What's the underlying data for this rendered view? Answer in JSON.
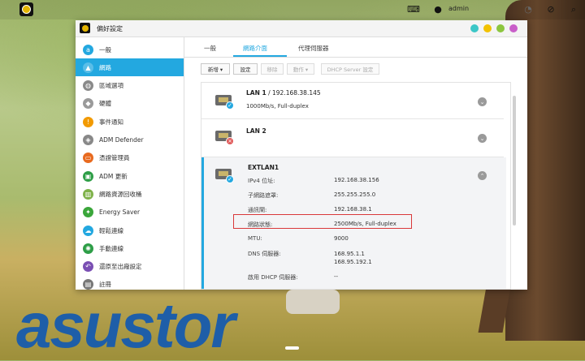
{
  "topbar": {
    "user_label": "admin"
  },
  "window": {
    "title": "偏好設定",
    "control_colors": [
      "#3cc7c7",
      "#f2c200",
      "#8cc63f",
      "#c95ec9"
    ]
  },
  "sidebar": {
    "items": [
      {
        "label": "一般",
        "icon": "general-icon",
        "color": "#23a8e0"
      },
      {
        "label": "網路",
        "icon": "network-icon",
        "color": "#23a8e0",
        "active": true
      },
      {
        "label": "區域選項",
        "icon": "globe-icon",
        "color": "#8a8a8a"
      },
      {
        "label": "硬體",
        "icon": "hardware-icon",
        "color": "#9a9a9a"
      },
      {
        "label": "事件通知",
        "icon": "notification-icon",
        "color": "#f29a00"
      },
      {
        "label": "ADM Defender",
        "icon": "defender-icon",
        "color": "#888888"
      },
      {
        "label": "憑證管理員",
        "icon": "certificate-icon",
        "color": "#e86a1f"
      },
      {
        "label": "ADM 更新",
        "icon": "update-icon",
        "color": "#2e9e47"
      },
      {
        "label": "網路資源回收桶",
        "icon": "recycle-bin-icon",
        "color": "#7fb24a"
      },
      {
        "label": "Energy Saver",
        "icon": "energy-icon",
        "color": "#3aa63a"
      },
      {
        "label": "輕鬆連線",
        "icon": "cloud-connect-icon",
        "color": "#23a8e0"
      },
      {
        "label": "手動連線",
        "icon": "manual-connect-icon",
        "color": "#2e9e47"
      },
      {
        "label": "還原至出廠設定",
        "icon": "restore-icon",
        "color": "#7a4fb3"
      },
      {
        "label": "註冊",
        "icon": "register-icon",
        "color": "#777777"
      }
    ]
  },
  "tabs": [
    {
      "label": "一般"
    },
    {
      "label": "網路介面",
      "active": true
    },
    {
      "label": "代理伺服器"
    }
  ],
  "toolbar": {
    "add": "新增 ▾",
    "settings": "設定",
    "remove": "移除",
    "action": "動作 ▾",
    "dhcp": "DHCP Server 設定"
  },
  "interfaces": [
    {
      "name": "LAN 1",
      "ip": " / 192.168.38.145",
      "sub": "1000Mb/s, Full-duplex",
      "status": "ok"
    },
    {
      "name": "LAN 2",
      "ip": "",
      "sub": "",
      "status": "error"
    },
    {
      "name": "EXTLAN1",
      "ip": "",
      "sub": "",
      "status": "ok",
      "details": [
        {
          "label": "IPv4 位址:",
          "value": "192.168.38.156"
        },
        {
          "label": "子網路遮罩:",
          "value": "255.255.255.0"
        },
        {
          "label": "通訊閘:",
          "value": "192.168.38.1"
        },
        {
          "label": "網路狀態:",
          "value": "2500Mb/s, Full-duplex"
        },
        {
          "label": "MTU:",
          "value": "9000"
        },
        {
          "label": "DNS 伺服器:",
          "value": "168.95.1.1\n168.95.192.1"
        },
        {
          "label": "啟用 DHCP 伺服器:",
          "value": "--"
        }
      ]
    }
  ],
  "logo_text": "asustor"
}
